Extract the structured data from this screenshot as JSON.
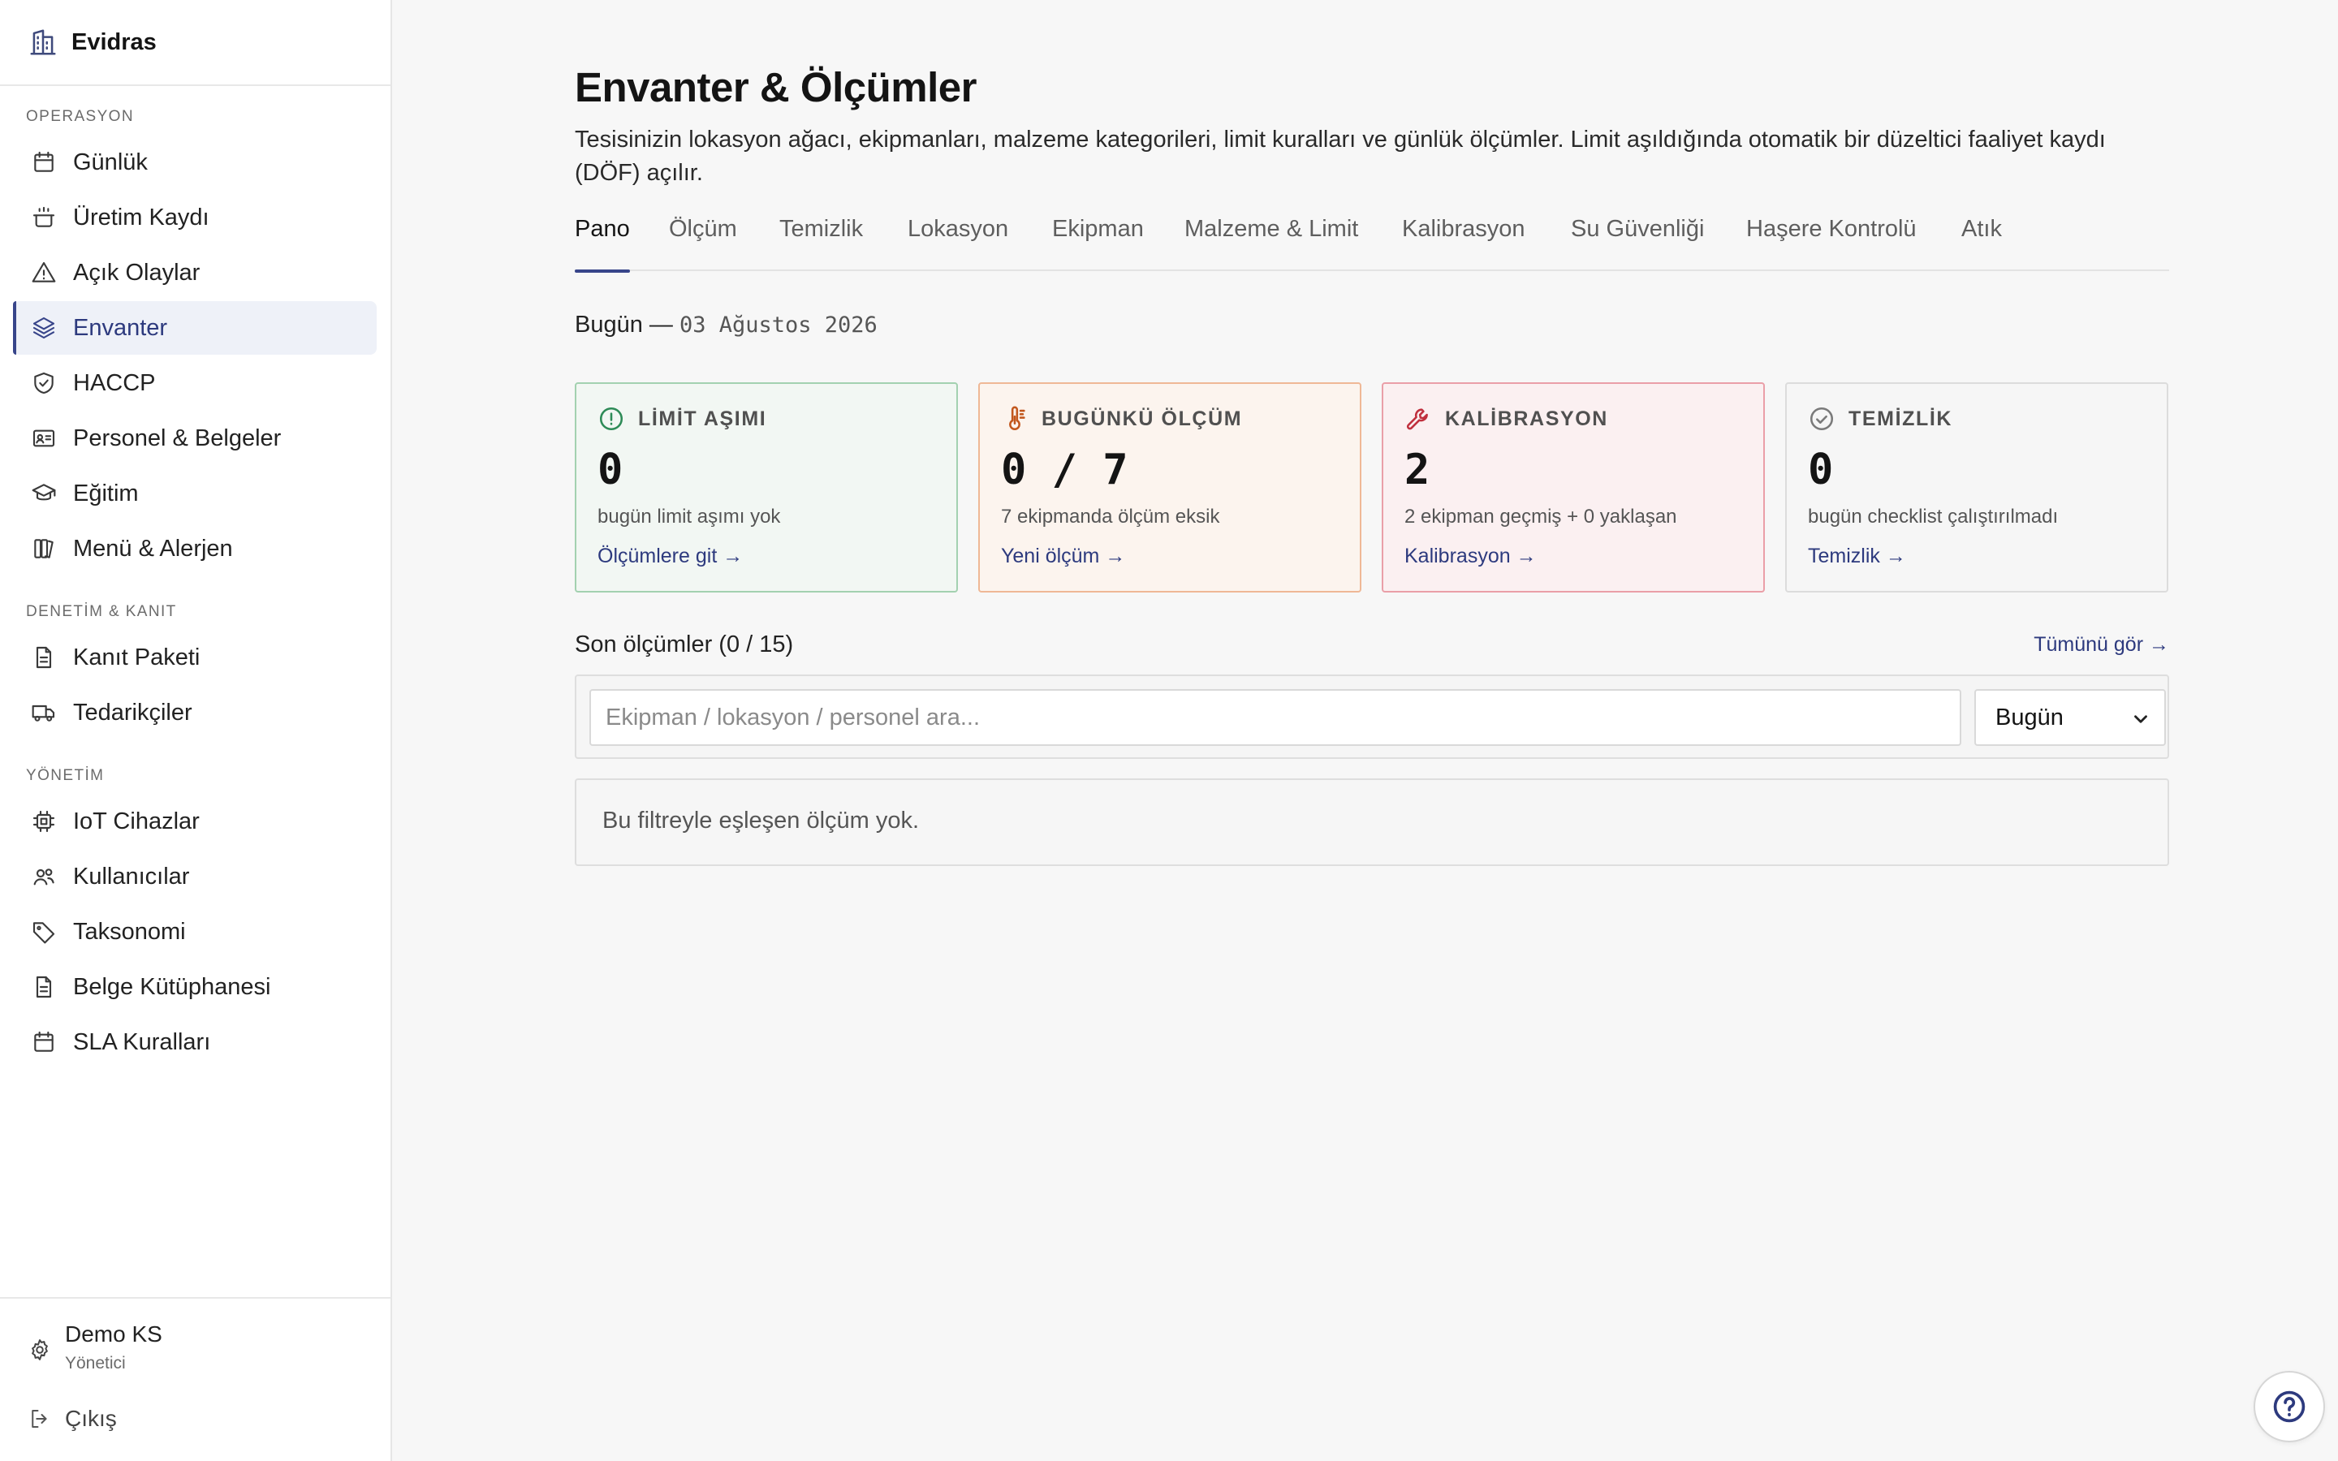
{
  "brand": {
    "name": "Evidras",
    "icon": "building-icon"
  },
  "sidebar": {
    "sections": [
      {
        "label": "OPERASYON"
      },
      {
        "label": "DENETİM & KANIT"
      },
      {
        "label": "YÖNETİM"
      }
    ],
    "items": [
      {
        "label": "Günlük",
        "icon": "calendar-icon"
      },
      {
        "label": "Üretim Kaydı",
        "icon": "cooking-pot-icon"
      },
      {
        "label": "Açık Olaylar",
        "icon": "warning-triangle-icon"
      },
      {
        "label": "Envanter",
        "icon": "layers-icon",
        "active": true
      },
      {
        "label": "HACCP",
        "icon": "shield-check-icon"
      },
      {
        "label": "Personel & Belgeler",
        "icon": "id-card-icon"
      },
      {
        "label": "Eğitim",
        "icon": "graduation-cap-icon"
      },
      {
        "label": "Menü & Alerjen",
        "icon": "book-icon"
      },
      {
        "label": "Kanıt Paketi",
        "icon": "document-icon"
      },
      {
        "label": "Tedarikçiler",
        "icon": "truck-icon"
      },
      {
        "label": "IoT Cihazlar",
        "icon": "chip-icon"
      },
      {
        "label": "Kullanıcılar",
        "icon": "users-icon"
      },
      {
        "label": "Taksonomi",
        "icon": "tag-icon"
      },
      {
        "label": "Belge Kütüphanesi",
        "icon": "document-icon"
      },
      {
        "label": "SLA Kuralları",
        "icon": "calendar-icon"
      }
    ],
    "user": {
      "name": "Demo KS",
      "role": "Yönetici",
      "icon": "gear-icon"
    },
    "logout": {
      "label": "Çıkış",
      "icon": "logout-icon"
    }
  },
  "page": {
    "title": "Envanter & Ölçümler",
    "description": "Tesisinizin lokasyon ağacı, ekipmanları, malzeme kategorileri, limit kuralları ve günlük ölçümler. Limit aşıldığında otomatik bir düzeltici faaliyet kaydı (DÖF) açılır."
  },
  "tabs": [
    {
      "label": "Pano",
      "active": true
    },
    {
      "label": "Ölçüm"
    },
    {
      "label": "Temizlik"
    },
    {
      "label": "Lokasyon"
    },
    {
      "label": "Ekipman"
    },
    {
      "label": "Malzeme & Limit"
    },
    {
      "label": "Kalibrasyon"
    },
    {
      "label": "Su Güvenliği"
    },
    {
      "label": "Haşere Kontrolü"
    },
    {
      "label": "Atık"
    }
  ],
  "today": {
    "prefix": "Bugün —",
    "date": "03 Ağustos 2026"
  },
  "cards": [
    {
      "title": "LİMİT AŞIMI",
      "value": "0",
      "subtitle": "bugün limit aşımı yok",
      "link": "Ölçümlere git →",
      "icon": "alert-circle-icon",
      "color": "#2e8b57"
    },
    {
      "title": "BUGÜNKÜ ÖLÇÜM",
      "value": "0 / 7",
      "subtitle": "7 ekipmanda ölçüm eksik",
      "link": "Yeni ölçüm →",
      "icon": "thermometer-icon",
      "color": "#c2571d"
    },
    {
      "title": "KALİBRASYON",
      "value": "2",
      "subtitle": "2 ekipman geçmiş + 0 yaklaşan",
      "link": "Kalibrasyon →",
      "icon": "wrench-icon",
      "color": "#c0303e"
    },
    {
      "title": "TEMİZLİK",
      "value": "0",
      "subtitle": "bugün checklist çalıştırılmadı",
      "link": "Temizlik →",
      "icon": "check-circle-icon",
      "color": "#7a7a7a"
    }
  ],
  "measurements": {
    "title": "Son ölçümler (0 / 15)",
    "see_all": "Tümünü gör →",
    "search_placeholder": "Ekipman / lokasyon / personel ara...",
    "period_value": "Bugün",
    "empty_text": "Bu filtreyle eşleşen ölçüm yok."
  },
  "help": {
    "icon": "help-circle-icon"
  }
}
